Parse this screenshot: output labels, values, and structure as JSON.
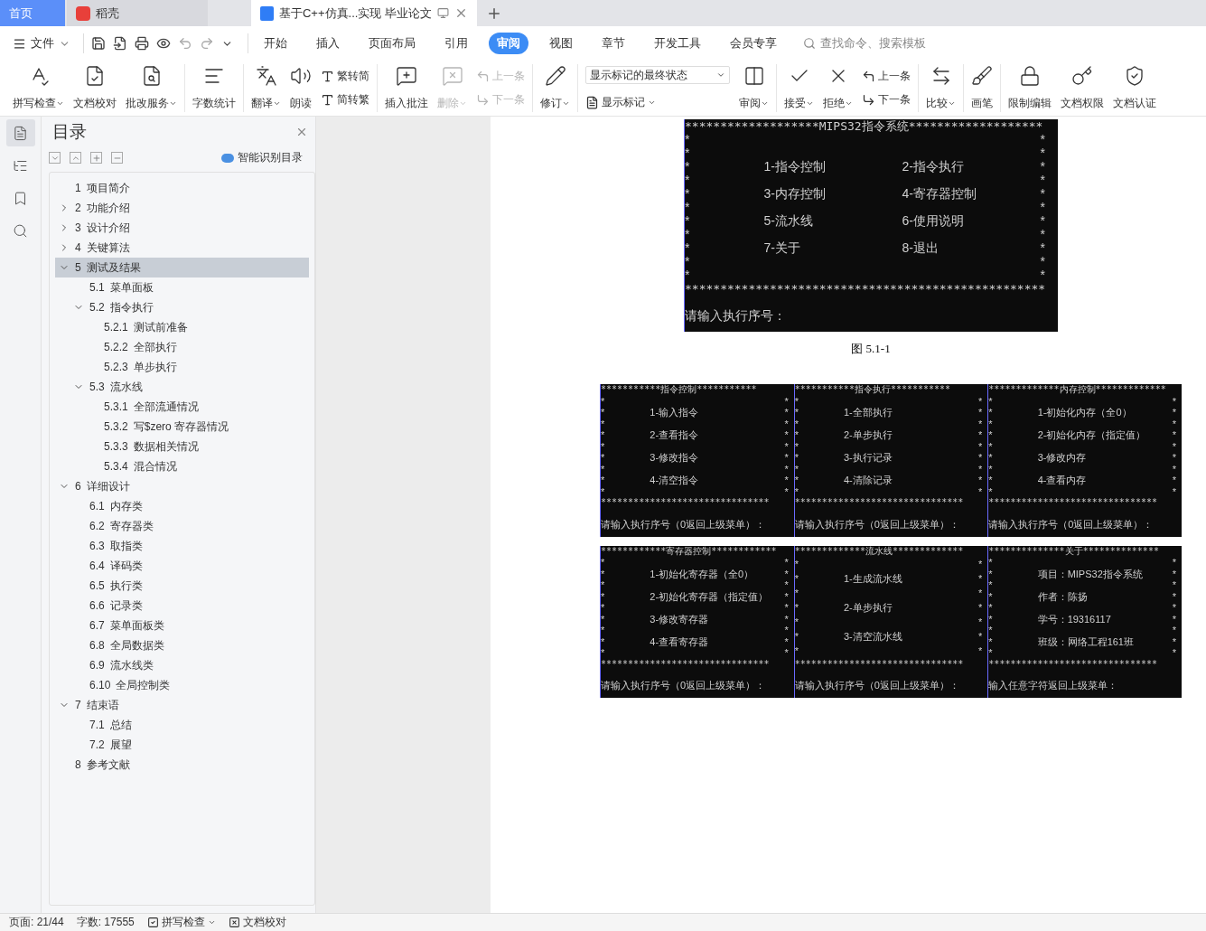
{
  "tabs": [
    {
      "label": "首页",
      "kind": "home",
      "selected": false
    },
    {
      "label": "稻壳",
      "kind": "app",
      "selected": false
    },
    {
      "label": "基于C++仿真...实现 毕业论文",
      "kind": "doc",
      "selected": true
    }
  ],
  "menu": {
    "file_label": "文件",
    "search_placeholder": "查找命令、搜索模板",
    "tabs": [
      {
        "label": "开始",
        "selected": false
      },
      {
        "label": "插入",
        "selected": false
      },
      {
        "label": "页面布局",
        "selected": false
      },
      {
        "label": "引用",
        "selected": false
      },
      {
        "label": "审阅",
        "selected": true
      },
      {
        "label": "视图",
        "selected": false
      },
      {
        "label": "章节",
        "selected": false
      },
      {
        "label": "开发工具",
        "selected": false
      },
      {
        "label": "会员专享",
        "selected": false
      }
    ]
  },
  "ribbon": {
    "groups": [
      {
        "items": [
          {
            "kind": "large",
            "label": "拼写检查",
            "caret": true,
            "disabled": false
          },
          {
            "kind": "large",
            "label": "文档校对",
            "caret": false,
            "disabled": false
          },
          {
            "kind": "large",
            "label": "批改服务",
            "caret": true,
            "disabled": false
          }
        ]
      },
      {
        "items": [
          {
            "kind": "large",
            "label": "字数统计",
            "caret": false,
            "disabled": false
          }
        ]
      },
      {
        "items": [
          {
            "kind": "large",
            "label": "翻译",
            "caret": true,
            "disabled": false
          },
          {
            "kind": "large",
            "label": "朗读",
            "caret": false,
            "disabled": false
          },
          {
            "kind": "stack",
            "rows": [
              "繁转简",
              "简转繁"
            ],
            "disabled": false
          }
        ]
      },
      {
        "items": [
          {
            "kind": "large",
            "label": "插入批注",
            "caret": false,
            "disabled": false
          },
          {
            "kind": "large",
            "label": "删除",
            "caret": true,
            "disabled": true
          },
          {
            "kind": "stack",
            "rows": [
              "上一条",
              "下一条"
            ],
            "disabled": true
          }
        ]
      },
      {
        "items": [
          {
            "kind": "large",
            "label": "修订",
            "caret": true,
            "disabled": false
          }
        ]
      },
      {
        "items": [
          {
            "kind": "select",
            "value": "显示标记的最终状态",
            "option_label": "显示标记"
          },
          {
            "kind": "large",
            "label": "审阅",
            "caret": true,
            "disabled": false
          }
        ]
      },
      {
        "items": [
          {
            "kind": "large",
            "label": "接受",
            "caret": true,
            "disabled": false
          },
          {
            "kind": "large",
            "label": "拒绝",
            "caret": true,
            "disabled": false
          },
          {
            "kind": "stack",
            "rows": [
              "上一条",
              "下一条"
            ],
            "disabled": false
          }
        ]
      },
      {
        "items": [
          {
            "kind": "large",
            "label": "比较",
            "caret": true,
            "disabled": false
          }
        ]
      },
      {
        "items": [
          {
            "kind": "large",
            "label": "画笔",
            "caret": false,
            "disabled": false
          }
        ]
      },
      {
        "items": [
          {
            "kind": "large",
            "label": "限制编辑",
            "caret": false,
            "disabled": false
          },
          {
            "kind": "large",
            "label": "文档权限",
            "caret": false,
            "disabled": false
          },
          {
            "kind": "large",
            "label": "文档认证",
            "caret": false,
            "disabled": false
          }
        ]
      }
    ]
  },
  "nav": {
    "title": "目录",
    "smart_label": "智能识别目录",
    "items": [
      {
        "num": "1",
        "title": "项目简介",
        "kind": "leaf",
        "selected": false
      },
      {
        "num": "2",
        "title": "功能介绍",
        "kind": "branch",
        "expanded": false,
        "selected": false
      },
      {
        "num": "3",
        "title": "设计介绍",
        "kind": "branch",
        "expanded": false,
        "selected": false
      },
      {
        "num": "4",
        "title": "关键算法",
        "kind": "branch",
        "expanded": false,
        "selected": false
      },
      {
        "num": "5",
        "title": "测试及结果",
        "kind": "branch",
        "expanded": true,
        "selected": true,
        "children": [
          {
            "num": "5.1",
            "title": "菜单面板",
            "kind": "leaf",
            "selected": false
          },
          {
            "num": "5.2",
            "title": "指令执行",
            "kind": "branch",
            "expanded": true,
            "selected": false,
            "children": [
              {
                "num": "5.2.1",
                "title": "测试前准备",
                "kind": "leaf",
                "selected": false
              },
              {
                "num": "5.2.2",
                "title": "全部执行",
                "kind": "leaf",
                "selected": false
              },
              {
                "num": "5.2.3",
                "title": "单步执行",
                "kind": "leaf",
                "selected": false
              }
            ]
          },
          {
            "num": "5.3",
            "title": "流水线",
            "kind": "branch",
            "expanded": true,
            "selected": false,
            "children": [
              {
                "num": "5.3.1",
                "title": "全部流通情况",
                "kind": "leaf",
                "selected": false
              },
              {
                "num": "5.3.2",
                "title": "写$zero 寄存器情况",
                "kind": "leaf",
                "selected": false
              },
              {
                "num": "5.3.3",
                "title": "数据相关情况",
                "kind": "leaf",
                "selected": false
              },
              {
                "num": "5.3.4",
                "title": "混合情况",
                "kind": "leaf",
                "selected": false
              }
            ]
          }
        ]
      },
      {
        "num": "6",
        "title": "详细设计",
        "kind": "branch",
        "expanded": true,
        "selected": false,
        "children": [
          {
            "num": "6.1",
            "title": "内存类",
            "kind": "leaf",
            "selected": false
          },
          {
            "num": "6.2",
            "title": "寄存器类",
            "kind": "leaf",
            "selected": false
          },
          {
            "num": "6.3",
            "title": "取指类",
            "kind": "leaf",
            "selected": false
          },
          {
            "num": "6.4",
            "title": "译码类",
            "kind": "leaf",
            "selected": false
          },
          {
            "num": "6.5",
            "title": "执行类",
            "kind": "leaf",
            "selected": false
          },
          {
            "num": "6.6",
            "title": "记录类",
            "kind": "leaf",
            "selected": false
          },
          {
            "num": "6.7",
            "title": "菜单面板类",
            "kind": "leaf",
            "selected": false
          },
          {
            "num": "6.8",
            "title": "全局数据类",
            "kind": "leaf",
            "selected": false
          },
          {
            "num": "6.9",
            "title": "流水线类",
            "kind": "leaf",
            "selected": false
          },
          {
            "num": "6.10",
            "title": "全局控制类",
            "kind": "leaf",
            "selected": false
          }
        ]
      },
      {
        "num": "7",
        "title": "结束语",
        "kind": "branch",
        "expanded": true,
        "selected": false,
        "children": [
          {
            "num": "7.1",
            "title": "总结",
            "kind": "leaf",
            "selected": false
          },
          {
            "num": "7.2",
            "title": "展望",
            "kind": "leaf",
            "selected": false
          }
        ]
      },
      {
        "num": "8",
        "title": "参考文献",
        "kind": "leaf",
        "selected": false
      }
    ]
  },
  "document": {
    "main_console": {
      "header": "*******************MIPS32指令系统*******************",
      "rows": [
        {
          "left": "*",
          "right": "*"
        },
        {
          "left": "*",
          "right": "*"
        },
        {
          "left": "*",
          "items": [
            "1-指令控制",
            "2-指令执行"
          ],
          "right": "*"
        },
        {
          "left": "*",
          "right": "*"
        },
        {
          "left": "*",
          "items": [
            "3-内存控制",
            "4-寄存器控制"
          ],
          "right": "*"
        },
        {
          "left": "*",
          "right": "*"
        },
        {
          "left": "*",
          "items": [
            "5-流水线",
            "6-使用说明"
          ],
          "right": "*"
        },
        {
          "left": "*",
          "right": "*"
        },
        {
          "left": "*",
          "items": [
            "7-关于",
            "8-退出"
          ],
          "right": "*"
        },
        {
          "left": "*",
          "right": "*"
        },
        {
          "left": "*",
          "right": "*"
        }
      ],
      "rule": "***************************************************",
      "prompt": "请输入执行序号："
    },
    "caption": "图 5.1-1",
    "consoles": [
      {
        "header": "***********指令控制***********",
        "rows": [
          {
            "left": "*",
            "right": "*"
          },
          {
            "left": "*",
            "items": [
              "1-输入指令"
            ],
            "right": "*"
          },
          {
            "left": "*",
            "right": "*"
          },
          {
            "left": "*",
            "items": [
              "2-查看指令"
            ],
            "right": "*"
          },
          {
            "left": "*",
            "right": "*"
          },
          {
            "left": "*",
            "items": [
              "3-修改指令"
            ],
            "right": "*"
          },
          {
            "left": "*",
            "right": "*"
          },
          {
            "left": "*",
            "items": [
              "4-清空指令"
            ],
            "right": "*"
          },
          {
            "left": "*",
            "right": "*"
          }
        ],
        "rule": "*******************************",
        "prompt": "请输入执行序号（0返回上级菜单）："
      },
      {
        "header": "***********指令执行***********",
        "rows": [
          {
            "left": "*",
            "right": "*"
          },
          {
            "left": "*",
            "items": [
              "1-全部执行"
            ],
            "right": "*"
          },
          {
            "left": "*",
            "right": "*"
          },
          {
            "left": "*",
            "items": [
              "2-单步执行"
            ],
            "right": "*"
          },
          {
            "left": "*",
            "right": "*"
          },
          {
            "left": "*",
            "items": [
              "3-执行记录"
            ],
            "right": "*"
          },
          {
            "left": "*",
            "right": "*"
          },
          {
            "left": "*",
            "items": [
              "4-清除记录"
            ],
            "right": "*"
          },
          {
            "left": "*",
            "right": "*"
          }
        ],
        "rule": "*******************************",
        "prompt": "请输入执行序号（0返回上级菜单）："
      },
      {
        "header": "*************内存控制*************",
        "rows": [
          {
            "left": "*",
            "right": "*"
          },
          {
            "left": "*",
            "items": [
              "1-初始化内存（全0）"
            ],
            "right": "*"
          },
          {
            "left": "*",
            "right": "*"
          },
          {
            "left": "*",
            "items": [
              "2-初始化内存（指定值）"
            ],
            "right": "*"
          },
          {
            "left": "*",
            "right": "*"
          },
          {
            "left": "*",
            "items": [
              "3-修改内存"
            ],
            "right": "*"
          },
          {
            "left": "*",
            "right": "*"
          },
          {
            "left": "*",
            "items": [
              "4-查看内存"
            ],
            "right": "*"
          },
          {
            "left": "*",
            "right": "*"
          }
        ],
        "rule": "*******************************",
        "prompt": "请输入执行序号（0返回上级菜单）："
      },
      {
        "header": "************寄存器控制************",
        "rows": [
          {
            "left": "*",
            "right": "*"
          },
          {
            "left": "*",
            "items": [
              "1-初始化寄存器（全0）"
            ],
            "right": "*"
          },
          {
            "left": "*",
            "right": "*"
          },
          {
            "left": "*",
            "items": [
              "2-初始化寄存器（指定值）"
            ],
            "right": "*"
          },
          {
            "left": "*",
            "right": "*"
          },
          {
            "left": "*",
            "items": [
              "3-修改寄存器"
            ],
            "right": "*"
          },
          {
            "left": "*",
            "right": "*"
          },
          {
            "left": "*",
            "items": [
              "4-查看寄存器"
            ],
            "right": "*"
          },
          {
            "left": "*",
            "right": "*"
          }
        ],
        "rule": "*******************************",
        "prompt": "请输入执行序号（0返回上级菜单）："
      },
      {
        "header": "*************流水线*************",
        "rows": [
          {
            "left": "*",
            "right": "*"
          },
          {
            "left": "*",
            "items": [
              "1-生成流水线"
            ],
            "right": "*"
          },
          {
            "left": "*",
            "right": "*"
          },
          {
            "left": "*",
            "items": [
              "2-单步执行"
            ],
            "right": "*"
          },
          {
            "left": "*",
            "right": "*"
          },
          {
            "left": "*",
            "items": [
              "3-清空流水线"
            ],
            "right": "*"
          },
          {
            "left": "*",
            "right": "*"
          }
        ],
        "rule": "*******************************",
        "prompt": "请输入执行序号（0返回上级菜单）："
      },
      {
        "header": "**************关于**************",
        "rows": [
          {
            "left": "*",
            "right": "*"
          },
          {
            "left": "*",
            "items": [
              "项目：MIPS32指令系统"
            ],
            "right": "*"
          },
          {
            "left": "*",
            "right": "*"
          },
          {
            "left": "*",
            "items": [
              "作者：陈扬"
            ],
            "right": "*"
          },
          {
            "left": "*",
            "right": "*"
          },
          {
            "left": "*",
            "items": [
              "学号：19316117"
            ],
            "right": "*"
          },
          {
            "left": "*",
            "right": "*"
          },
          {
            "left": "*",
            "items": [
              "班级：网络工程161班"
            ],
            "right": "*"
          },
          {
            "left": "*",
            "right": "*"
          }
        ],
        "rule": "*******************************",
        "prompt": "输入任意字符返回上级菜单："
      }
    ]
  },
  "status_bar": {
    "page": "页面: 21/44",
    "words": "字数: 17555",
    "spell": "拼写检查",
    "proofread": "文档校对"
  }
}
